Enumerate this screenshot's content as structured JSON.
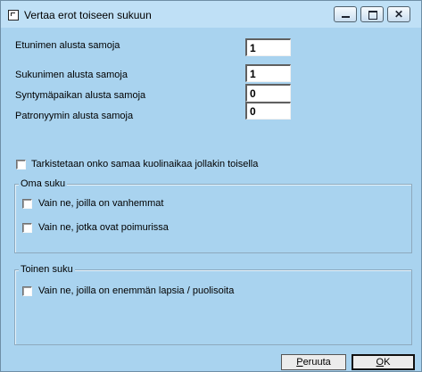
{
  "window": {
    "title": "Vertaa erot toiseen sukuun",
    "icon": "window-app-icon",
    "controls": [
      "minimize-icon",
      "maximize-icon",
      "close-icon"
    ]
  },
  "fields": [
    {
      "label": "Etunimen alusta samoja",
      "value": "1"
    },
    {
      "label": "Sukunimen alusta samoja",
      "value": "1"
    },
    {
      "label": "Syntymäpaikan alusta samoja",
      "value": "0"
    },
    {
      "label": "Patronyymin alusta samoja",
      "value": "0"
    }
  ],
  "death_check": {
    "label": "Tarkistetaan onko samaa kuolinaikaa jollakin toisella",
    "checked": false
  },
  "oma_suku": {
    "legend": "Oma suku",
    "options": [
      {
        "label": "Vain ne, joilla on vanhemmat",
        "checked": false
      },
      {
        "label": "Vain ne, jotka ovat poimurissa",
        "checked": false
      }
    ]
  },
  "toinen_suku": {
    "legend": "Toinen suku",
    "options": [
      {
        "label": "Vain ne, joilla on enemmän lapsia / puolisoita",
        "checked": false
      }
    ]
  },
  "buttons": {
    "cancel_mnemonic": "P",
    "cancel_rest": "eruuta",
    "ok_mnemonic": "O",
    "ok_rest": "K"
  },
  "colors": {
    "background": "#a9d3ef",
    "titlebar": "#bfe0f6"
  }
}
